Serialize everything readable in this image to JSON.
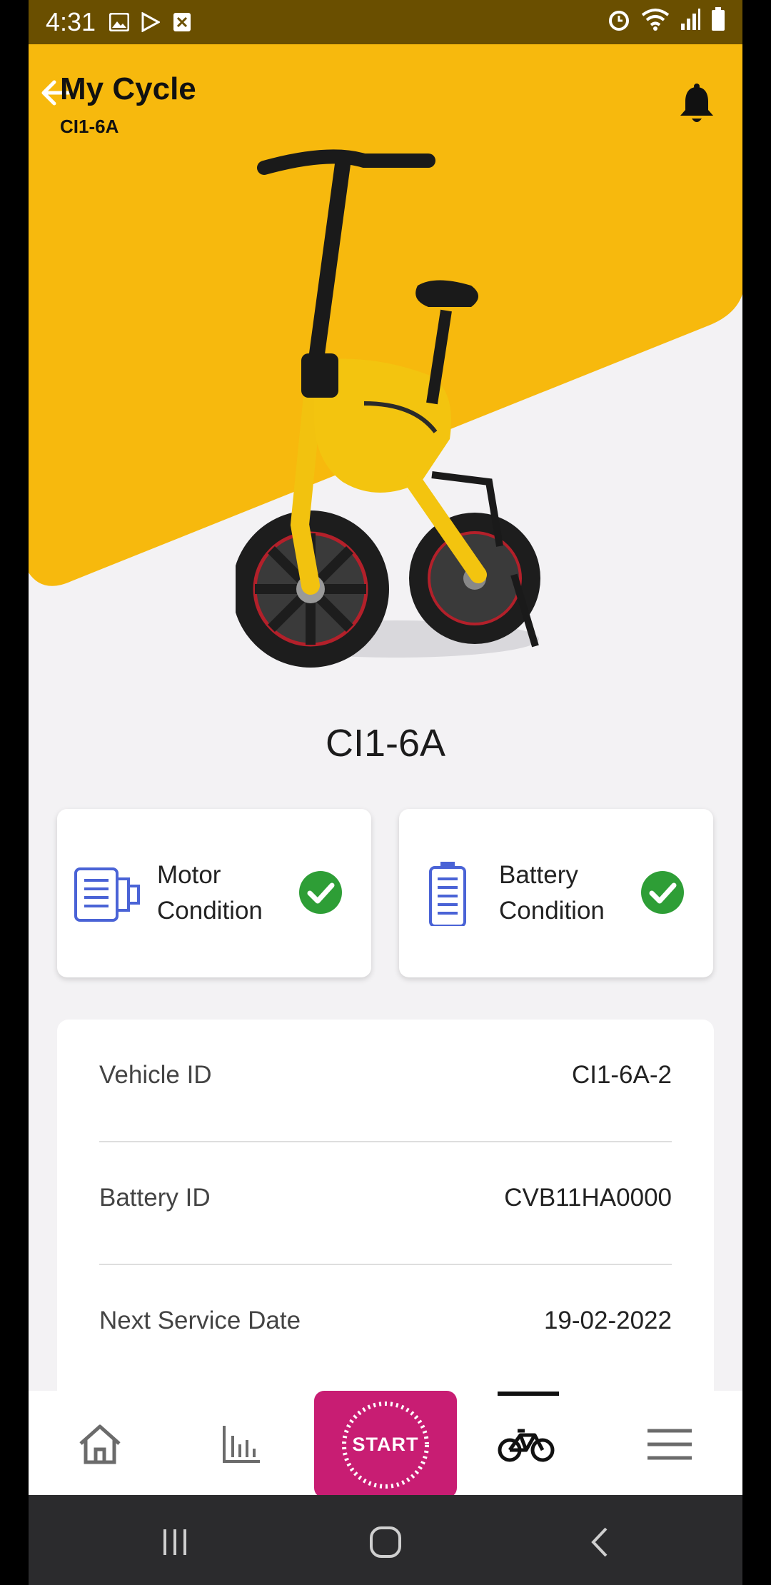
{
  "status_bar": {
    "time": "4:31"
  },
  "header": {
    "title": "My Cycle",
    "subtitle": "CI1-6A"
  },
  "vehicle": {
    "name": "CI1-6A"
  },
  "conditions": [
    {
      "label": "Motor Condition",
      "status": "ok"
    },
    {
      "label": "Battery Condition",
      "status": "ok"
    }
  ],
  "details": [
    {
      "label": "Vehicle ID",
      "value": "CI1-6A-2"
    },
    {
      "label": "Battery ID",
      "value": "CVB11HA0000"
    },
    {
      "label": "Next Service Date",
      "value": "19-02-2022"
    }
  ],
  "nav": {
    "start_label": "START",
    "items": [
      "home-icon",
      "stats-icon",
      "start-button",
      "bicycle-icon",
      "menu-icon"
    ],
    "active": "bicycle-icon"
  },
  "colors": {
    "accent_yellow": "#f7b90d",
    "start_magenta": "#c81d73",
    "check_green": "#2e9e36",
    "icon_blue": "#4a63d6"
  }
}
